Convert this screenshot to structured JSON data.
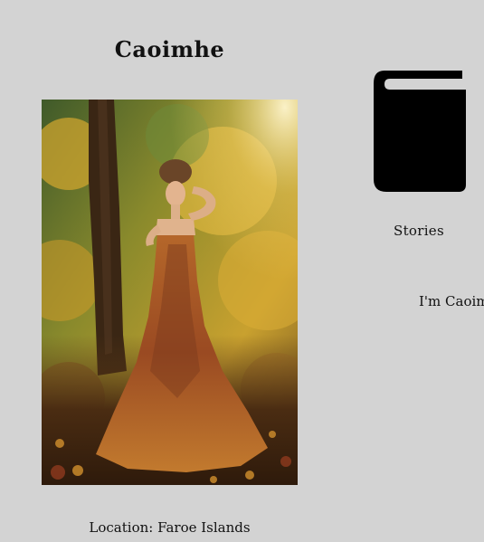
{
  "profile": {
    "name": "Caoimhe",
    "location": "Location: Faroe Islands",
    "intro": "I'm Caoim"
  },
  "nav": {
    "stories_label": "Stories",
    "stories_icon": "book-icon"
  },
  "colors": {
    "page_background": "#d3d3d3",
    "text": "#111111"
  }
}
